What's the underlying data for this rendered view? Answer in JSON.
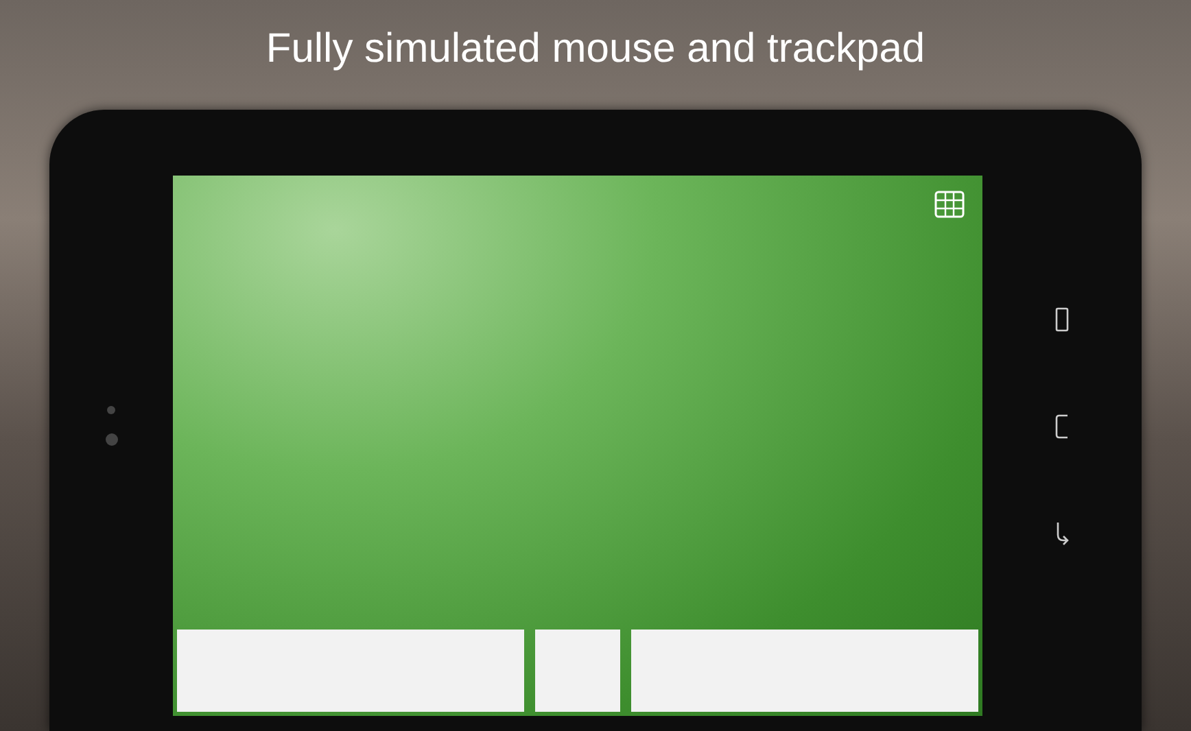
{
  "headline": "Fully simulated mouse and trackpad"
}
